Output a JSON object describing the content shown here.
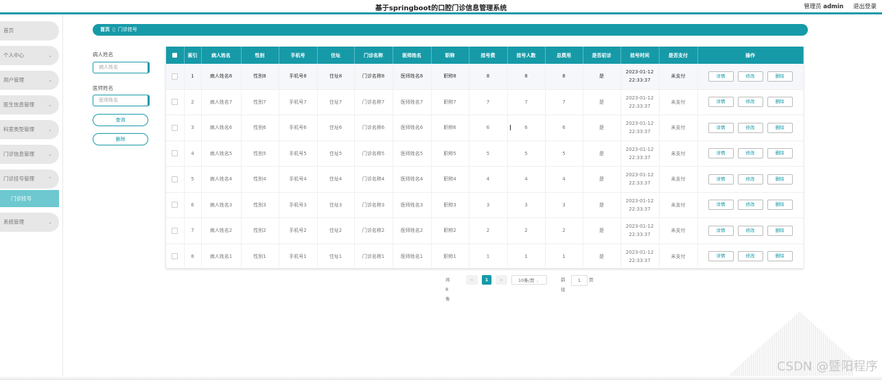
{
  "header": {
    "title": "基于springboot的口腔门诊信息管理系统",
    "user_role": "管理员",
    "user_name": "admin",
    "logout": "退出登录"
  },
  "sidebar": {
    "items": [
      {
        "label": "首页",
        "chevron": ""
      },
      {
        "label": "个人中心",
        "chevron": "⌄"
      },
      {
        "label": "用户管理",
        "chevron": "⌄"
      },
      {
        "label": "医生信息管理",
        "chevron": "⌄"
      },
      {
        "label": "科室类型管理",
        "chevron": "⌄"
      },
      {
        "label": "门诊信息管理",
        "chevron": "⌄"
      },
      {
        "label": "门诊挂号管理",
        "chevron": "⌃"
      },
      {
        "label": "系统管理",
        "chevron": "⌄"
      }
    ],
    "sub_item": "门诊挂号"
  },
  "breadcrumb": {
    "home": "首页",
    "separator": "▯",
    "current": "门诊挂号"
  },
  "search": {
    "patient_label": "病人姓名",
    "patient_placeholder": "病人姓名",
    "doctor_label": "医师姓名",
    "doctor_placeholder": "医师姓名",
    "query_button": "查询",
    "delete_button": "删除"
  },
  "table": {
    "headers": [
      "索引",
      "病人姓名",
      "性别",
      "手机号",
      "住址",
      "门诊名称",
      "医师姓名",
      "职称",
      "挂号费",
      "挂号人数",
      "总费用",
      "是否初诊",
      "挂号时间",
      "是否支付",
      "操作"
    ],
    "actions": [
      "详情",
      "修改",
      "删除"
    ],
    "rows": [
      [
        "1",
        "病人姓名8",
        "性别8",
        "手机号8",
        "住址8",
        "门诊名称8",
        "医师姓名8",
        "职称8",
        "8",
        "8",
        "8",
        "是",
        "2023-01-12",
        "22:33:37",
        "未支付"
      ],
      [
        "2",
        "病人姓名7",
        "性别7",
        "手机号7",
        "住址7",
        "门诊名称7",
        "医师姓名7",
        "职称7",
        "7",
        "7",
        "7",
        "是",
        "2023-01-12",
        "22:33:37",
        "未支付"
      ],
      [
        "3",
        "病人姓名6",
        "性别6",
        "手机号6",
        "住址6",
        "门诊名称6",
        "医师姓名6",
        "职称6",
        "6",
        "6",
        "6",
        "是",
        "2023-01-12",
        "22:33:37",
        "未支付"
      ],
      [
        "4",
        "病人姓名5",
        "性别5",
        "手机号5",
        "住址5",
        "门诊名称5",
        "医师姓名5",
        "职称5",
        "5",
        "5",
        "5",
        "是",
        "2023-01-12",
        "22:33:37",
        "未支付"
      ],
      [
        "5",
        "病人姓名4",
        "性别4",
        "手机号4",
        "住址4",
        "门诊名称4",
        "医师姓名4",
        "职称4",
        "4",
        "4",
        "4",
        "是",
        "2023-01-12",
        "22:33:37",
        "未支付"
      ],
      [
        "6",
        "病人姓名3",
        "性别3",
        "手机号3",
        "住址3",
        "门诊名称3",
        "医师姓名3",
        "职称3",
        "3",
        "3",
        "3",
        "是",
        "2023-01-12",
        "22:33:37",
        "未支付"
      ],
      [
        "7",
        "病人姓名2",
        "性别2",
        "手机号2",
        "住址2",
        "门诊名称2",
        "医师姓名2",
        "职称2",
        "2",
        "2",
        "2",
        "是",
        "2023-01-12",
        "22:33:37",
        "未支付"
      ],
      [
        "8",
        "病人姓名1",
        "性别1",
        "手机号1",
        "住址1",
        "门诊名称1",
        "医师姓名1",
        "职称1",
        "1",
        "1",
        "1",
        "是",
        "2023-01-12",
        "22:33:37",
        "未支付"
      ]
    ]
  },
  "pagination": {
    "total": "共 8 条",
    "prev": "<",
    "current_page": "1",
    "next": ">",
    "page_size": "10条/页",
    "goto_label": "前往",
    "goto_value": "1",
    "page_suffix": "页"
  },
  "watermark": "CSDN @暨阳程序",
  "colors": {
    "accent": "#169aa8",
    "submenu": "#6ec8cf",
    "menu_bg": "#e7e7e7"
  }
}
